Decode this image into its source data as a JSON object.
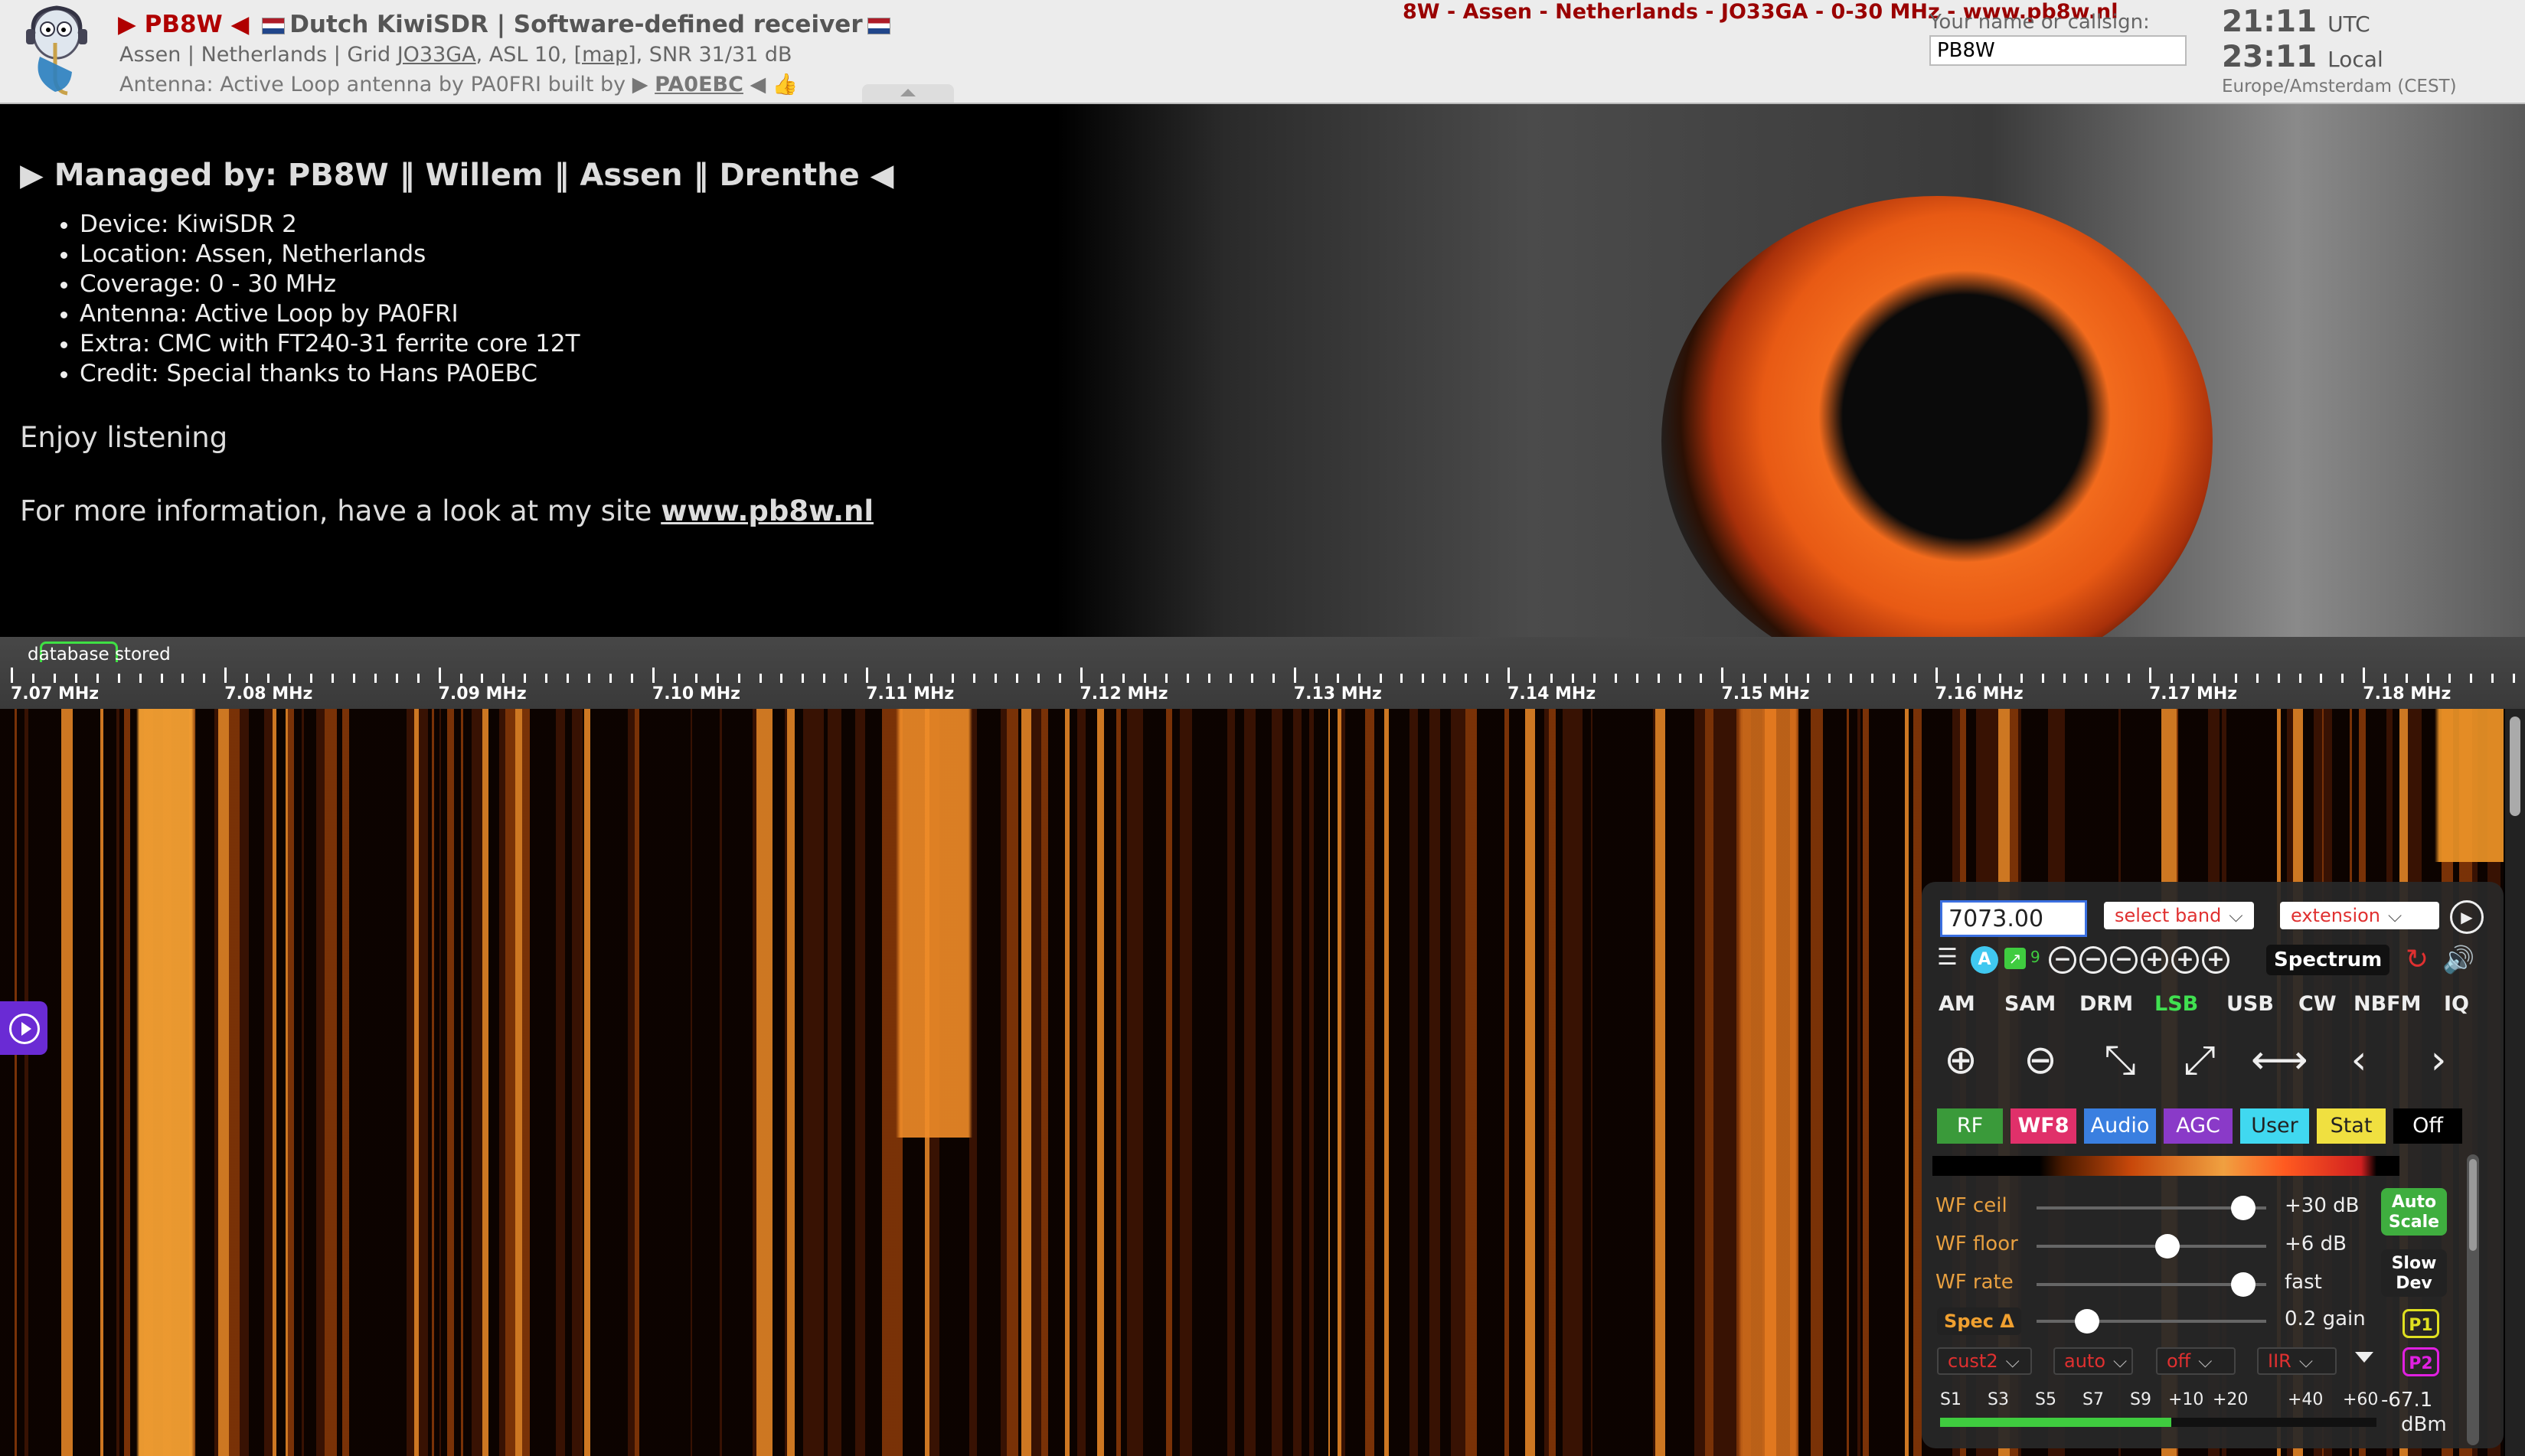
{
  "header": {
    "callsign": "PB8W",
    "title": "Dutch KiwiSDR | Software-defined receiver",
    "line2_prefix": "Assen | Netherlands | Grid ",
    "grid": "JO33GA",
    "asl": ", ASL 10, ",
    "map": "[map]",
    "snr": ", SNR 31/31 dB",
    "antenna_prefix": "Antenna: Active Loop antenna by PA0FRI built by ",
    "antenna_builder": "PA0EBC",
    "thumb": "👍",
    "marquee": "8W - Assen - Netherlands - JO33GA - 0-30 MHz - www.pb8w.nl",
    "callsign_label": "Your name or callsign:",
    "callsign_value": "PB8W",
    "utc_time": "21:11",
    "utc_label": "UTC",
    "local_time": "23:11",
    "local_label": "Local",
    "timezone": "Europe/Amsterdam (CEST)"
  },
  "banner": {
    "managed": "Managed by: PB8W ‖ Willem ‖ Assen ‖ Drenthe",
    "items": [
      {
        "label": "Device: KiwiSDR 2",
        "link": ""
      },
      {
        "label": "Location: Assen, Netherlands",
        "link": ""
      },
      {
        "label": "Coverage: 0 - 30 MHz",
        "link": ""
      },
      {
        "label": "Antenna: ",
        "link": "Active Loop by PA0FRI"
      },
      {
        "label": "Extra: CMC with FT240-31 ferrite core 12T",
        "link": ""
      },
      {
        "label": "Credit: Special thanks to ",
        "link": "Hans PA0EBC"
      }
    ],
    "enjoy": "Enjoy listening",
    "more_prefix": "For more information, have a look at my site ",
    "more_link": "www.pb8w.nl"
  },
  "scale": {
    "status": "database stored",
    "labels": [
      "7.07 MHz",
      "7.08 MHz",
      "7.09 MHz",
      "7.10 MHz",
      "7.11 MHz",
      "7.12 MHz",
      "7.13 MHz",
      "7.14 MHz",
      "7.15 MHz",
      "7.16 MHz",
      "7.17 MHz",
      "7.18 MHz"
    ]
  },
  "panel": {
    "frequency": "7073.00",
    "band_select": "select band",
    "extension_select": "extension",
    "spectrum_label": "Spectrum",
    "badge_a": "A",
    "badge_num": "9",
    "modes": [
      "AM",
      "SAM",
      "DRM",
      "LSB",
      "USB",
      "CW",
      "NBFM",
      "IQ"
    ],
    "active_mode": "LSB",
    "tabs": [
      {
        "label": "RF",
        "color": "#3a9a3a"
      },
      {
        "label": "WF8",
        "color": "#e0306a"
      },
      {
        "label": "Audio",
        "color": "#3a7fe0"
      },
      {
        "label": "AGC",
        "color": "#8a3ac8"
      },
      {
        "label": "User",
        "color": "#40d8f0"
      },
      {
        "label": "Stat",
        "color": "#f0e040"
      },
      {
        "label": "Off",
        "color": "#000000"
      }
    ],
    "wf_ceil_label": "WF ceil",
    "wf_ceil_value": "+30 dB",
    "wf_ceil_level": 0.9,
    "wf_floor_label": "WF floor",
    "wf_floor_value": "+6 dB",
    "wf_floor_level": 0.57,
    "wf_rate_label": "WF rate",
    "wf_rate_value": "fast",
    "wf_rate_level": 0.9,
    "spec_label": "Spec Δ",
    "spec_value": "0.2 gain",
    "spec_level": 0.22,
    "auto_scale": "Auto Scale",
    "slow_dev": "Slow Dev",
    "p1": "P1",
    "p2": "P2",
    "sel_cmap": "cust2",
    "sel_auto": "auto",
    "sel_off": "off",
    "sel_iir": "IIR",
    "smeter_labels": [
      "S1",
      "S3",
      "S5",
      "S7",
      "S9",
      "+10",
      "+20",
      "+40",
      "+60"
    ],
    "smeter_level": 0.53,
    "dbm_value": "-67.1",
    "dbm_unit": "dBm"
  }
}
